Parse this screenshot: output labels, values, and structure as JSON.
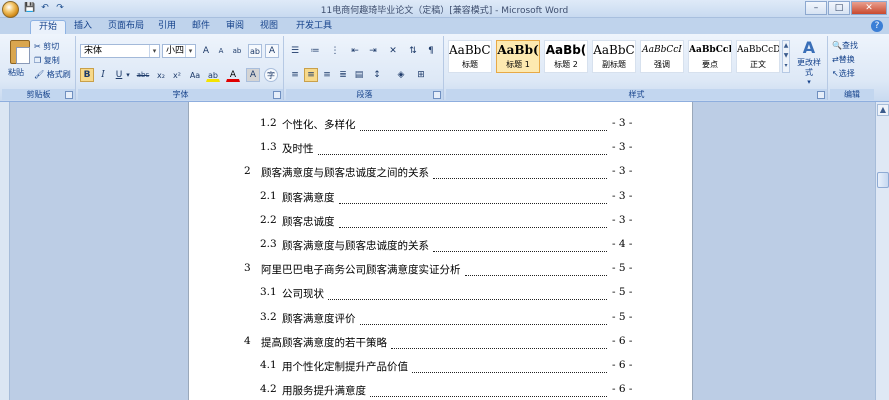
{
  "window": {
    "title": "11电商何趣琦毕业论文（定稿）[兼容模式] - Microsoft Word",
    "buttons": {
      "minimize": "–",
      "maximize": "□",
      "close": "✕"
    }
  },
  "quick_access": {
    "save": "💾",
    "undo": "↶",
    "redo": "↷"
  },
  "tabs": [
    {
      "label": "开始",
      "active": true
    },
    {
      "label": "插入"
    },
    {
      "label": "页面布局"
    },
    {
      "label": "引用"
    },
    {
      "label": "邮件"
    },
    {
      "label": "审阅"
    },
    {
      "label": "视图"
    },
    {
      "label": "开发工具"
    }
  ],
  "ribbon": {
    "clipboard": {
      "label": "剪贴板",
      "paste": "粘贴",
      "cut": "剪切",
      "copy": "复制",
      "format_painter": "格式刷"
    },
    "font": {
      "label": "字体",
      "font_name": "宋体",
      "font_size": "小四",
      "grow": "A",
      "shrink": "A",
      "bold": "B",
      "italic": "I",
      "underline": "U",
      "strike": "abc",
      "subscript": "x₂",
      "superscript": "x²",
      "highlight": "ab",
      "font_color": "A",
      "char_shading": "A",
      "enclose": "字"
    },
    "paragraph": {
      "label": "段落"
    },
    "styles": {
      "label": "样式",
      "items": [
        {
          "sample": "AaBbC(",
          "name": "标题"
        },
        {
          "sample": "AaBb(",
          "name": "标题 1",
          "selected": true
        },
        {
          "sample": "AaBb(",
          "name": "标题 2"
        },
        {
          "sample": "AaBbC",
          "name": "副标题"
        },
        {
          "sample": "AaBbCcI",
          "name": "强调"
        },
        {
          "sample": "AaBbCcD",
          "name": "要点"
        },
        {
          "sample": "AaBbCcDc",
          "name": "正文"
        }
      ],
      "change_styles": "更改样式"
    },
    "editing": {
      "label": "编辑",
      "find": "查找",
      "replace": "替换",
      "select": "选择"
    }
  },
  "document": {
    "toc": [
      {
        "num": "1.2",
        "title": "个性化、多样化",
        "page": "- 3 -",
        "level": 2
      },
      {
        "num": "1.3",
        "title": "及时性",
        "page": "- 3 -",
        "level": 2
      },
      {
        "num": "2",
        "title": "顾客满意度与顾客忠诚度之间的关系",
        "page": "- 3 -",
        "level": 1
      },
      {
        "num": "2.1",
        "title": "顾客满意度",
        "page": "- 3 -",
        "level": 2
      },
      {
        "num": "2.2",
        "title": "顾客忠诚度",
        "page": "- 3 -",
        "level": 2
      },
      {
        "num": "2.3",
        "title": "顾客满意度与顾客忠诚度的关系",
        "page": "- 4 -",
        "level": 2
      },
      {
        "num": "3",
        "title": "阿里巴巴电子商务公司顾客满意度实证分析",
        "page": "- 5 -",
        "level": 1
      },
      {
        "num": "3.1",
        "title": "公司现状",
        "page": "- 5 -",
        "level": 2
      },
      {
        "num": "3.2",
        "title": "顾客满意度评价",
        "page": "- 5 -",
        "level": 2
      },
      {
        "num": "4",
        "title": "提高顾客满意度的若干策略",
        "page": "- 6 -",
        "level": 1
      },
      {
        "num": "4.1",
        "title": "用个性化定制提升产品价值",
        "page": "- 6 -",
        "level": 2
      },
      {
        "num": "4.2",
        "title": "用服务提升满意度",
        "page": "- 6 -",
        "level": 2
      }
    ]
  }
}
